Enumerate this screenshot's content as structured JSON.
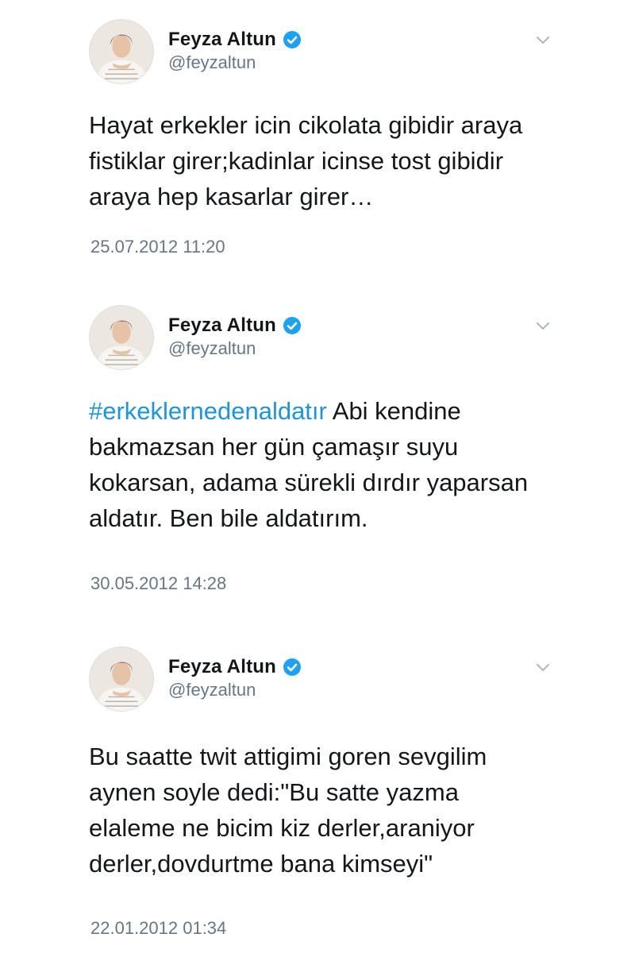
{
  "tweets": [
    {
      "author": {
        "name": "Feyza Altun",
        "handle": "@feyzaltun",
        "verified": true
      },
      "text": "Hayat erkekler icin cikolata gibidir araya fistiklar girer;kadinlar icinse tost gibidir araya hep kasarlar girer…",
      "timestamp": "25.07.2012 11:20"
    },
    {
      "author": {
        "name": "Feyza Altun",
        "handle": "@feyzaltun",
        "verified": true
      },
      "hashtag": "#erkeklernedenaldatır",
      "text": "Abi kendine bakmazsan her gün çamaşır suyu kokarsan, adama sürekli dırdır yaparsan aldatır. Ben bile aldatırım.",
      "timestamp": "30.05.2012 14:28"
    },
    {
      "author": {
        "name": "Feyza Altun",
        "handle": "@feyzaltun",
        "verified": true
      },
      "text": "Bu saatte twit attigimi goren sevgilim aynen soyle dedi:\"Bu satte yazma elaleme ne bicim kiz derler,araniyor derler,dovdurtme bana kimseyi\"",
      "timestamp": "22.01.2012 01:34"
    }
  ],
  "icons": {
    "verified": "verified-badge-icon",
    "caret": "chevron-down-icon",
    "avatar": "profile-photo"
  },
  "colors": {
    "text": "#14171a",
    "secondary": "#657786",
    "link": "#1b95e0",
    "verified": "#1da1f2"
  }
}
